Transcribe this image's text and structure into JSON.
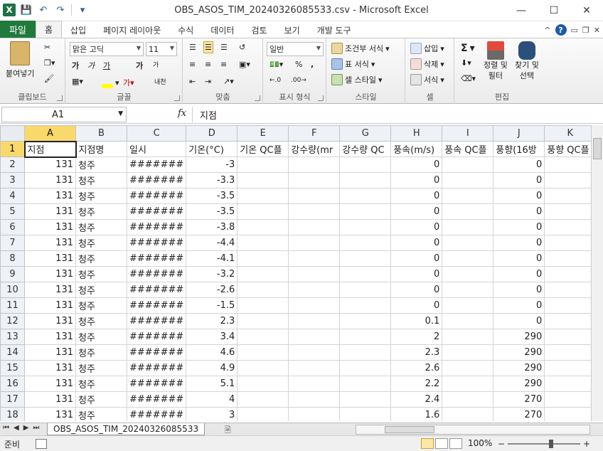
{
  "window": {
    "title": "OBS_ASOS_TIM_20240326085533.csv - Microsoft Excel",
    "app_icon": "X",
    "min_glyph": "—",
    "max_glyph": "☐",
    "close_glyph": "✕"
  },
  "ribbon_tabs": [
    "파일",
    "홈",
    "삽입",
    "페이지 레이아웃",
    "수식",
    "데이터",
    "검토",
    "보기",
    "개발 도구"
  ],
  "active_tab": "홈",
  "ribbon": {
    "clipboard": {
      "paste_label": "붙여넣기",
      "group_label": "클립보드"
    },
    "font": {
      "font_name": "맑은 고딕",
      "font_size": "11",
      "group_label": "글꼴",
      "bold": "가",
      "italic": "가",
      "underline": "가",
      "grow": "가",
      "shrink": "가",
      "phonetic": "내천"
    },
    "alignment": {
      "group_label": "맞춤"
    },
    "number": {
      "format": "일반",
      "group_label": "표시 형식",
      "percent": "%",
      "comma": ","
    },
    "styles": {
      "conditional": "조건부 서식",
      "table": "표 서식",
      "cell": "셀 스타일",
      "group_label": "스타일"
    },
    "cells": {
      "insert": "삽입",
      "delete": "삭제",
      "format": "서식",
      "group_label": "셀"
    },
    "editing": {
      "sort": "정렬 및\n필터",
      "sort_line1": "정렬 및",
      "sort_line2": "필터",
      "find_line1": "찾기 및",
      "find_line2": "선택",
      "group_label": "편집",
      "sum": "Σ"
    }
  },
  "formula_bar": {
    "name_box": "A1",
    "fx": "fx",
    "content": "지점"
  },
  "columns": [
    "A",
    "B",
    "C",
    "D",
    "E",
    "F",
    "G",
    "H",
    "I",
    "J",
    "K"
  ],
  "header_row": [
    "지점",
    "지점명",
    "일시",
    "기온(°C)",
    "기온 QC플",
    "강수량(mr",
    "강수량 QC",
    "풍속(m/s)",
    "풍속 QC플",
    "풍향(16방",
    "풍향 QC플"
  ],
  "rows": [
    {
      "n": "2",
      "a": "131",
      "b": "청주",
      "c": "#######",
      "d": "-3",
      "h": "0",
      "j": "0"
    },
    {
      "n": "3",
      "a": "131",
      "b": "청주",
      "c": "#######",
      "d": "-3.3",
      "h": "0",
      "j": "0"
    },
    {
      "n": "4",
      "a": "131",
      "b": "청주",
      "c": "#######",
      "d": "-3.5",
      "h": "0",
      "j": "0"
    },
    {
      "n": "5",
      "a": "131",
      "b": "청주",
      "c": "#######",
      "d": "-3.5",
      "h": "0",
      "j": "0"
    },
    {
      "n": "6",
      "a": "131",
      "b": "청주",
      "c": "#######",
      "d": "-3.8",
      "h": "0",
      "j": "0"
    },
    {
      "n": "7",
      "a": "131",
      "b": "청주",
      "c": "#######",
      "d": "-4.4",
      "h": "0",
      "j": "0"
    },
    {
      "n": "8",
      "a": "131",
      "b": "청주",
      "c": "#######",
      "d": "-4.1",
      "h": "0",
      "j": "0"
    },
    {
      "n": "9",
      "a": "131",
      "b": "청주",
      "c": "#######",
      "d": "-3.2",
      "h": "0",
      "j": "0"
    },
    {
      "n": "10",
      "a": "131",
      "b": "청주",
      "c": "#######",
      "d": "-2.6",
      "h": "0",
      "j": "0"
    },
    {
      "n": "11",
      "a": "131",
      "b": "청주",
      "c": "#######",
      "d": "-1.5",
      "h": "0",
      "j": "0"
    },
    {
      "n": "12",
      "a": "131",
      "b": "청주",
      "c": "#######",
      "d": "2.3",
      "h": "0.1",
      "j": "0"
    },
    {
      "n": "13",
      "a": "131",
      "b": "청주",
      "c": "#######",
      "d": "3.4",
      "h": "2",
      "j": "290"
    },
    {
      "n": "14",
      "a": "131",
      "b": "청주",
      "c": "#######",
      "d": "4.6",
      "h": "2.3",
      "j": "290"
    },
    {
      "n": "15",
      "a": "131",
      "b": "청주",
      "c": "#######",
      "d": "4.9",
      "h": "2.6",
      "j": "290"
    },
    {
      "n": "16",
      "a": "131",
      "b": "청주",
      "c": "#######",
      "d": "5.1",
      "h": "2.2",
      "j": "290"
    },
    {
      "n": "17",
      "a": "131",
      "b": "청주",
      "c": "#######",
      "d": "4",
      "h": "2.4",
      "j": "270"
    },
    {
      "n": "18",
      "a": "131",
      "b": "청주",
      "c": "#######",
      "d": "3",
      "h": "1.6",
      "j": "270"
    }
  ],
  "sheet_tab": "OBS_ASOS_TIM_20240326085533",
  "status": {
    "ready": "준비",
    "zoom": "100%",
    "minus": "−",
    "plus": "+"
  },
  "colors": {
    "file_tab": "#1f7a3c",
    "selected_header": "#f9d96b",
    "excel_green": "#1e7145"
  }
}
